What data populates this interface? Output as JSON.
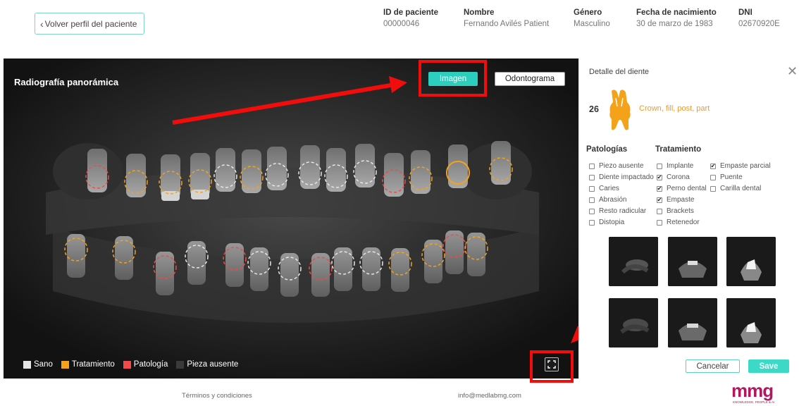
{
  "header": {
    "back_label": "Volver perfil del paciente",
    "patient": [
      {
        "label": "ID de paciente",
        "value": "00000046"
      },
      {
        "label": "Nombre",
        "value": "Fernando Avilés Patient"
      },
      {
        "label": "Género",
        "value": "Masculino"
      },
      {
        "label": "Fecha de nacimiento",
        "value": "30 de marzo de 1983"
      },
      {
        "label": "DNI",
        "value": "02670920E"
      }
    ]
  },
  "viewer": {
    "title": "Radiografía panorámica",
    "tab_image": "Imagen",
    "tab_odontogram": "Odontograma",
    "legend": [
      {
        "label": "Sano",
        "color": "#e6e6e6"
      },
      {
        "label": "Tratamiento",
        "color": "#f5a21b"
      },
      {
        "label": "Patología",
        "color": "#f04a4a"
      },
      {
        "label": "Pieza ausente",
        "color": "#3a3a3a"
      }
    ]
  },
  "detail": {
    "title": "Detalle del diente",
    "tooth_number": "26",
    "tooth_summary": "Crown, fill, post, part",
    "pathologies_title": "Patologías",
    "treatment_title": "Tratamiento",
    "pathologies": [
      {
        "label": "Piezo ausente",
        "checked": false
      },
      {
        "label": "Diente impactado",
        "checked": false
      },
      {
        "label": "Caries",
        "checked": false
      },
      {
        "label": "Abrasión",
        "checked": false
      },
      {
        "label": "Resto radicular",
        "checked": false
      },
      {
        "label": "Distopia",
        "checked": false
      }
    ],
    "treatments": [
      {
        "label": "Implante",
        "checked": false
      },
      {
        "label": "Corona",
        "checked": true
      },
      {
        "label": "Perno dental",
        "checked": true
      },
      {
        "label": "Empaste",
        "checked": true
      },
      {
        "label": "Brackets",
        "checked": false
      },
      {
        "label": "Retenedor",
        "checked": false
      }
    ],
    "treatments_extra": [
      {
        "label": "Empaste parcial",
        "checked": true
      },
      {
        "label": "Puente",
        "checked": false
      },
      {
        "label": "Carilla dental",
        "checked": false
      }
    ],
    "cancel_label": "Cancelar",
    "save_label": "Save"
  },
  "footer": {
    "terms": "Términos y condiciones",
    "email": "info@medlabmg.com",
    "logo_text": "mmg",
    "logo_tagline": "KNOWLEDGE, PEOPLE & AI"
  },
  "colors": {
    "accent": "#2ccfbd",
    "treatment": "#f5a21b",
    "pathology": "#f04a4a",
    "healthy": "#e6e6e6",
    "highlight": "#f20d0d",
    "logo": "#b0185f"
  }
}
